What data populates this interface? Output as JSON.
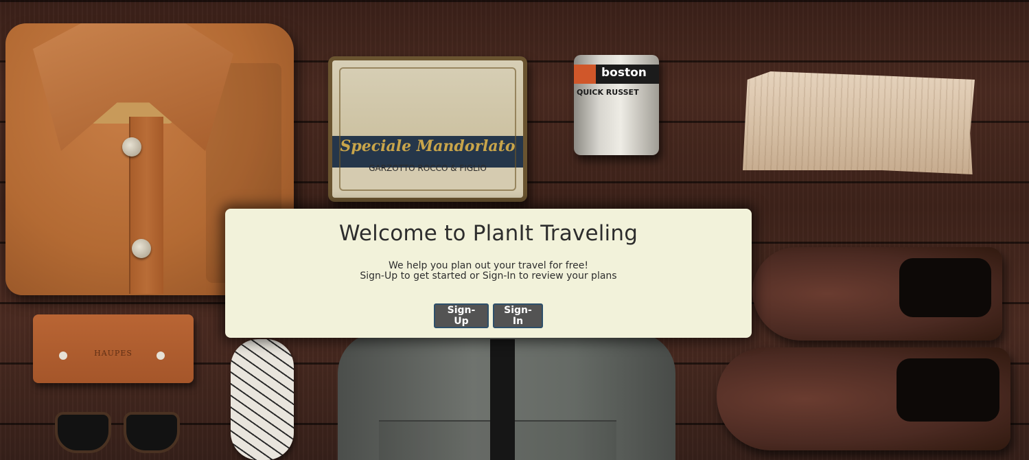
{
  "modal": {
    "title": "Welcome to PlanIt Traveling",
    "tagline": "We help you plan out your travel for free!",
    "instructions": "Sign-Up to get started or Sign-In to review your plans",
    "signup_label": "Sign-Up",
    "signin_label": "Sign-In"
  },
  "background": {
    "tin_text": "Speciale Mandorlato",
    "tin_subtext": "GARZOTTO ROCCO & FIGLIO",
    "can_text": "boston",
    "can_subtext": "QUICK RUSSET",
    "wallet_text": "HAUPES"
  },
  "colors": {
    "modal_bg": "#f2f2da",
    "button_bg": "#535353",
    "button_border": "#2d4f6a",
    "text": "#2d2d2d"
  }
}
